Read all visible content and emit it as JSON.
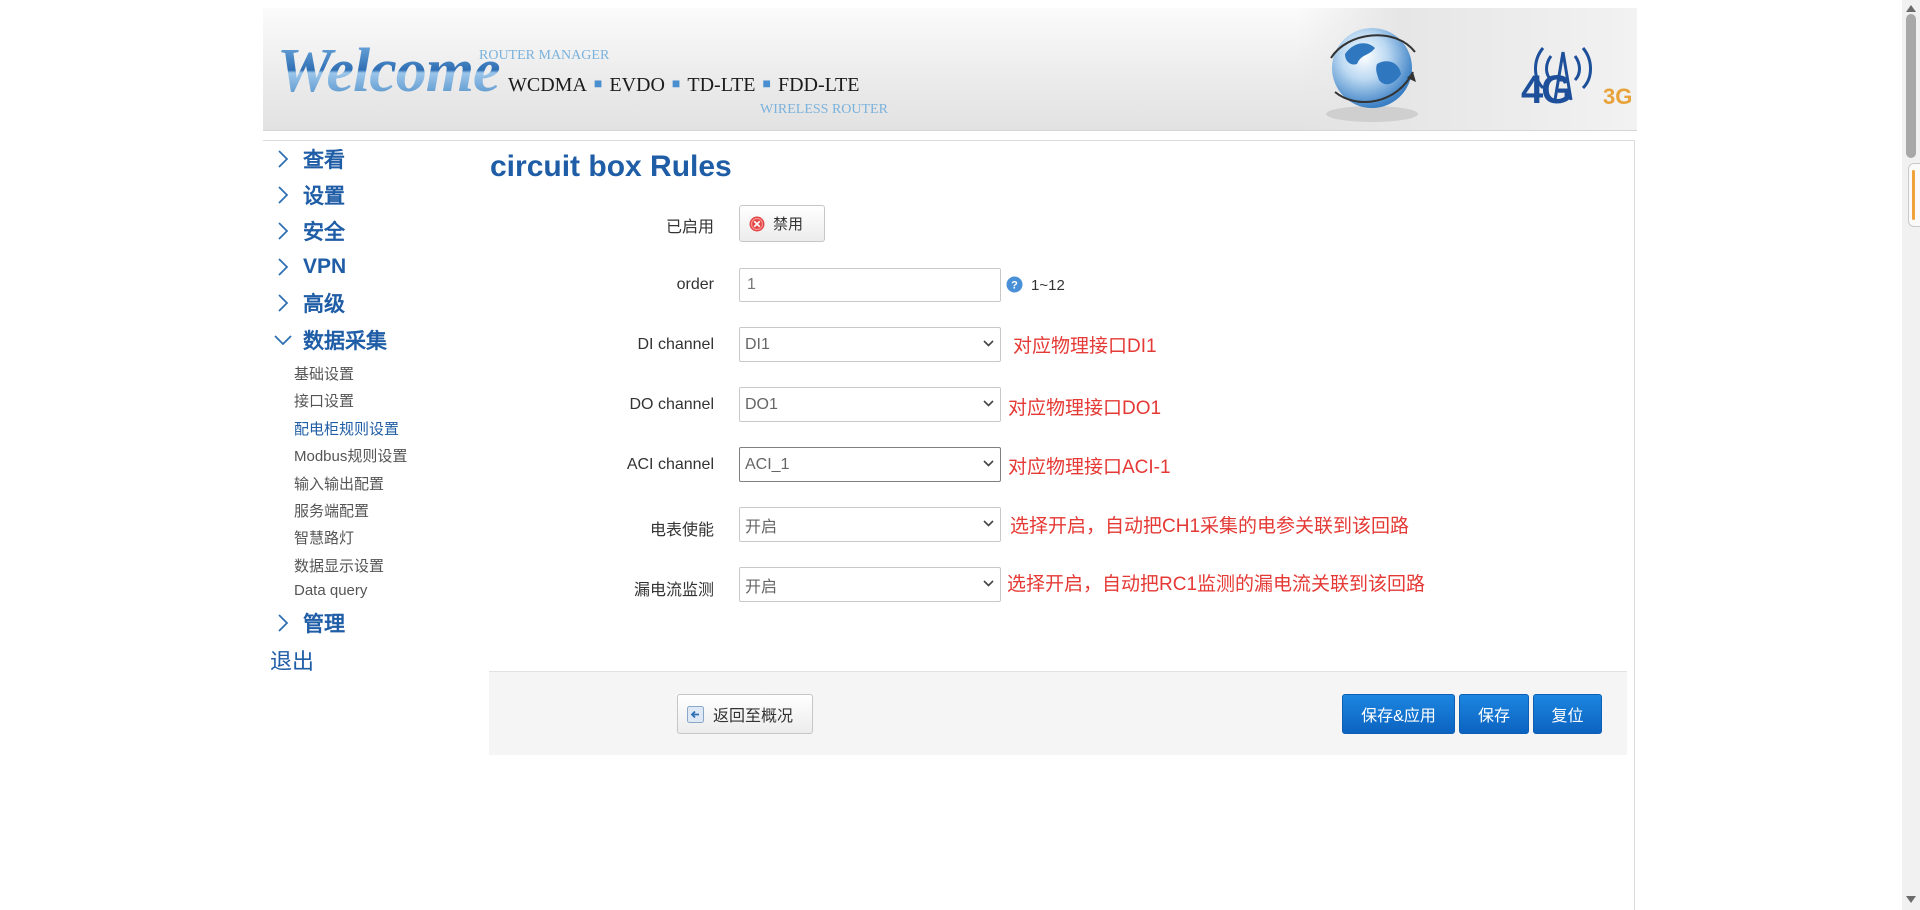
{
  "header": {
    "welcome": "Welcome",
    "router_manager": "ROUTER MANAGER",
    "networks": [
      "WCDMA",
      "EVDO",
      "TD-LTE",
      "FDD-LTE"
    ],
    "wireless_router": "WIRELESS ROUTER",
    "badge_4g": "4G",
    "badge_3g": "3G"
  },
  "sidebar": {
    "menu": [
      {
        "label": "查看",
        "expanded": false
      },
      {
        "label": "设置",
        "expanded": false
      },
      {
        "label": "安全",
        "expanded": false
      },
      {
        "label": "VPN",
        "expanded": false
      },
      {
        "label": "高级",
        "expanded": false
      },
      {
        "label": "数据采集",
        "expanded": true
      },
      {
        "label": "管理",
        "expanded": false
      }
    ],
    "submenu": [
      {
        "label": "基础设置"
      },
      {
        "label": "接口设置"
      },
      {
        "label": "配电柜规则设置",
        "active": true
      },
      {
        "label": "Modbus规则设置"
      },
      {
        "label": "输入输出配置"
      },
      {
        "label": "服务端配置"
      },
      {
        "label": "智慧路灯"
      },
      {
        "label": "数据显示设置"
      },
      {
        "label": "Data query"
      }
    ],
    "logout": "退出"
  },
  "page": {
    "title": "circuit box Rules"
  },
  "form": {
    "enabled": {
      "label": "已启用",
      "button": "禁用"
    },
    "order": {
      "label": "order",
      "value": "1",
      "help": "1~12"
    },
    "di": {
      "label": "DI channel",
      "value": "DI1",
      "note": "对应物理接口DI1"
    },
    "do": {
      "label": "DO channel",
      "value": "DO1",
      "note": "对应物理接口DO1"
    },
    "aci": {
      "label": "ACI channel",
      "value": "ACI_1",
      "note": "对应物理接口ACI-1"
    },
    "meter": {
      "label": "电表使能",
      "value": "开启",
      "note": "选择开启，自动把CH1采集的电参关联到该回路"
    },
    "leakage": {
      "label": "漏电流监测",
      "value": "开启",
      "note": "选择开启，自动把RC1监测的漏电流关联到该回路"
    }
  },
  "actions": {
    "back": "返回至概况",
    "save_apply": "保存&应用",
    "save": "保存",
    "reset": "复位"
  },
  "colors": {
    "primary_blue": "#1f5da6",
    "button_blue": "#0c63c0",
    "note_red": "#e53935",
    "accent_orange": "#f0a23b"
  },
  "icons": {
    "menu_collapsed": "chevron-right-icon",
    "menu_expanded": "chevron-down-icon",
    "disable": "close-circle-icon",
    "help": "question-icon",
    "back": "back-arrow-icon"
  }
}
